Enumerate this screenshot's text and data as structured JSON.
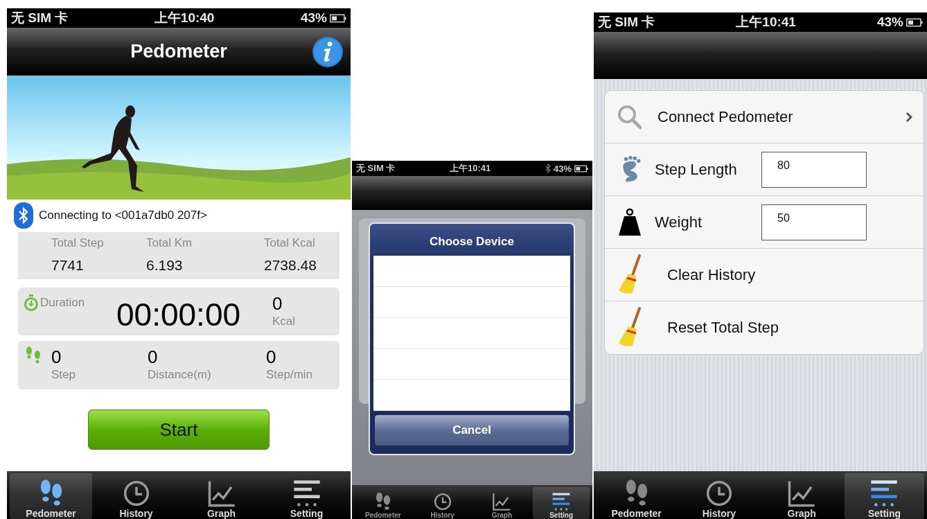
{
  "screens": [
    {
      "kind": "pedometer",
      "status_bar": {
        "carrier": "无 SIM 卡",
        "time": "上午10:40",
        "battery": "43%",
        "bluetooth": false
      },
      "nav_title": "Pedometer",
      "connection": "Connecting to <001a7db0 207f>",
      "totals": [
        {
          "label": "Total Step",
          "value": "7741"
        },
        {
          "label": "Total Km",
          "value": "6.193"
        },
        {
          "label": "Total Kcal",
          "value": "2738.48"
        }
      ],
      "duration": {
        "label": "Duration",
        "time": "00:00:00",
        "kcal_value": "0",
        "kcal_label": "Kcal"
      },
      "current": [
        {
          "value": "0",
          "label": "Step"
        },
        {
          "value": "0",
          "label": "Distance(m)"
        },
        {
          "value": "0",
          "label": "Step/min"
        }
      ],
      "start_button": "Start",
      "tabs": [
        {
          "label": "Pedometer",
          "selected": true
        },
        {
          "label": "History",
          "selected": false
        },
        {
          "label": "Graph",
          "selected": false
        },
        {
          "label": "Setting",
          "selected": false
        }
      ]
    },
    {
      "kind": "dialog",
      "status_bar": {
        "carrier": "无 SIM 卡",
        "time": "上午10:41",
        "battery": "43%",
        "bluetooth": true
      },
      "dialog": {
        "title": "Choose Device",
        "cancel_button": "Cancel"
      },
      "tabs": [
        {
          "label": "Pedometer",
          "selected": false
        },
        {
          "label": "History",
          "selected": false
        },
        {
          "label": "Graph",
          "selected": false
        },
        {
          "label": "Setting",
          "selected": true
        }
      ]
    },
    {
      "kind": "settings",
      "status_bar": {
        "carrier": "无 SIM 卡",
        "time": "上午10:41",
        "battery": "43%",
        "bluetooth": false
      },
      "settings": [
        {
          "kind": "link",
          "label": "Connect Pedometer"
        },
        {
          "kind": "length",
          "label": "Step Length",
          "value": "80"
        },
        {
          "kind": "weight",
          "label": "Weight",
          "value": "50"
        },
        {
          "kind": "action",
          "label": "Clear History"
        },
        {
          "kind": "action",
          "label": "Reset Total Step"
        }
      ],
      "tabs": [
        {
          "label": "Pedometer",
          "selected": false
        },
        {
          "label": "History",
          "selected": false
        },
        {
          "label": "Graph",
          "selected": false
        },
        {
          "label": "Setting",
          "selected": true
        }
      ]
    }
  ]
}
